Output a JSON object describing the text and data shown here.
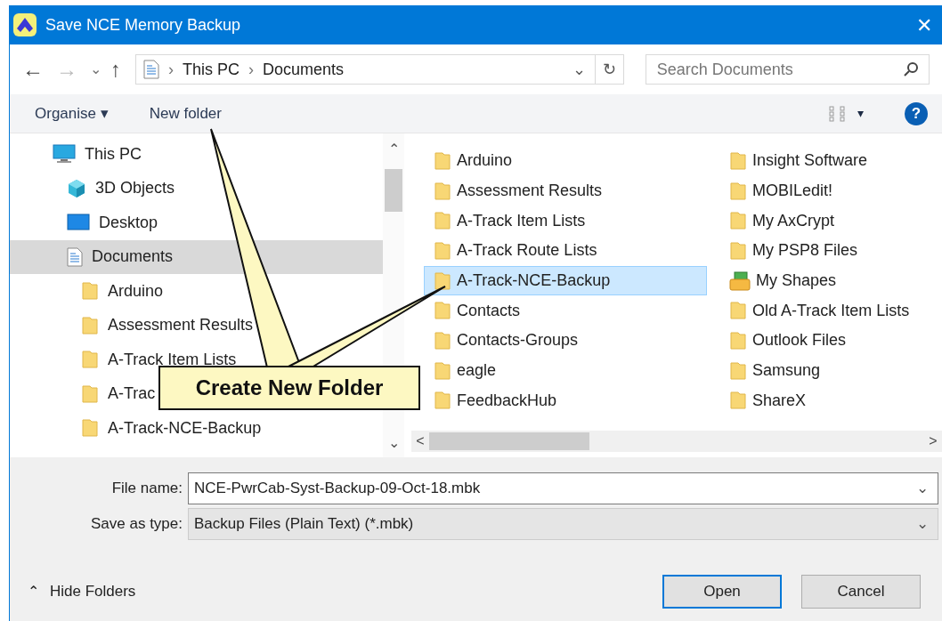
{
  "window": {
    "title": "Save NCE Memory Backup",
    "close": "✕"
  },
  "nav": {
    "back": "←",
    "forward": "→",
    "recent": "⌄",
    "up": "↑",
    "breadcrumb": [
      "This PC",
      "Documents"
    ],
    "separator": "›",
    "dropdown": "⌄",
    "refresh": "↻",
    "search": {
      "placeholder": "Search Documents"
    }
  },
  "toolbar": {
    "organise": "Organise ▾",
    "new_folder": "New folder",
    "view_caret": "▾",
    "help": "?"
  },
  "sidebar": {
    "items": [
      {
        "label": "This PC",
        "kind": "pc",
        "selected": false,
        "children": [
          {
            "label": "3D Objects",
            "kind": "objects",
            "selected": false
          },
          {
            "label": "Desktop",
            "kind": "desktop",
            "selected": false
          },
          {
            "label": "Documents",
            "kind": "documents",
            "selected": true,
            "children": [
              {
                "label": "Arduino",
                "kind": "folder",
                "selected": false
              },
              {
                "label": "Assessment Results",
                "kind": "folder",
                "selected": false
              },
              {
                "label": "A-Track Item Lists",
                "kind": "folder",
                "selected": false
              },
              {
                "label": "A-Trac",
                "kind": "folder",
                "selected": false
              },
              {
                "label": "A-Track-NCE-Backup",
                "kind": "folder",
                "selected": false
              }
            ]
          }
        ]
      }
    ],
    "scroll_up": "⌃",
    "scroll_down": "⌄"
  },
  "content": {
    "items": [
      {
        "label": "Arduino",
        "kind": "folder",
        "selected": false
      },
      {
        "label": "Assessment Results",
        "kind": "folder",
        "selected": false
      },
      {
        "label": "A-Track Item Lists",
        "kind": "folder",
        "selected": false
      },
      {
        "label": "A-Track Route Lists",
        "kind": "folder",
        "selected": false
      },
      {
        "label": "A-Track-NCE-Backup",
        "kind": "folder",
        "selected": true
      },
      {
        "label": "Contacts",
        "kind": "folder",
        "selected": false
      },
      {
        "label": "Contacts-Groups",
        "kind": "folder",
        "selected": false
      },
      {
        "label": "eagle",
        "kind": "folder",
        "selected": false
      },
      {
        "label": "FeedbackHub",
        "kind": "folder",
        "selected": false
      },
      {
        "label": "Insight Software",
        "kind": "folder",
        "selected": false
      },
      {
        "label": "MOBILedit!",
        "kind": "folder",
        "selected": false
      },
      {
        "label": "My AxCrypt",
        "kind": "folder",
        "selected": false
      },
      {
        "label": "My PSP8 Files",
        "kind": "folder",
        "selected": false
      },
      {
        "label": "My Shapes",
        "kind": "shapes",
        "selected": false
      },
      {
        "label": "Old A-Track Item Lists",
        "kind": "folder",
        "selected": false
      },
      {
        "label": "Outlook Files",
        "kind": "folder",
        "selected": false
      },
      {
        "label": "Samsung",
        "kind": "folder",
        "selected": false
      },
      {
        "label": "ShareX",
        "kind": "folder",
        "selected": false
      }
    ],
    "scroll_left": "<",
    "scroll_right": ">"
  },
  "form": {
    "file_name": {
      "label": "File name:",
      "value": "NCE-PwrCab-Syst-Backup-09-Oct-18.mbk"
    },
    "save_as_type": {
      "label": "Save as type:",
      "value": "Backup Files (Plain Text) (*.mbk)"
    },
    "caret": "⌄"
  },
  "footer": {
    "hide_folders": "Hide Folders",
    "hide_caret": "⌃",
    "open": "Open",
    "cancel": "Cancel"
  },
  "callout": {
    "text": "Create New Folder"
  }
}
